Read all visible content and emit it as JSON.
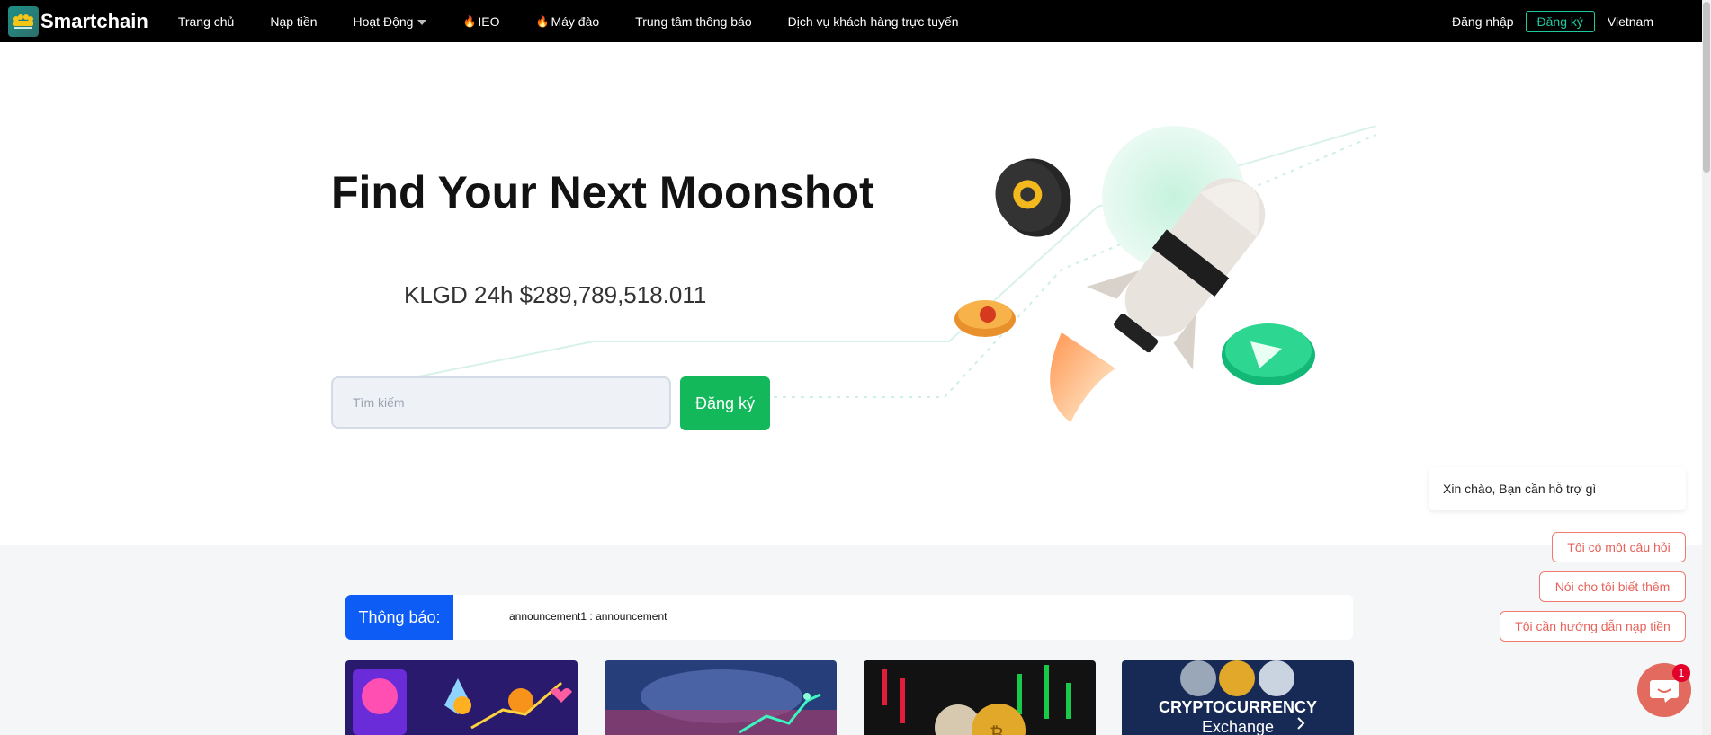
{
  "nav": {
    "brand": "Smartchain",
    "items": [
      {
        "label": "Trang chủ"
      },
      {
        "label": "Nạp tiền"
      },
      {
        "label": "Hoạt Động"
      },
      {
        "label": "IEO"
      },
      {
        "label": "Máy đào"
      },
      {
        "label": "Trung tâm thông báo"
      },
      {
        "label": "Dịch vụ khách hàng trực tuyến"
      }
    ],
    "login": "Đăng nhập",
    "register": "Đăng ký",
    "language": "Vietnam"
  },
  "hero": {
    "title": "Find Your Next Moonshot",
    "volume": "KLGD 24h $289,789,518.011",
    "search_placeholder": "Tìm kiếm",
    "button": "Đăng ký"
  },
  "notice": {
    "label": "Thông báo:",
    "text": "announcement1 : announcement"
  },
  "cards": [
    {
      "icon": "crypto-neon-image"
    },
    {
      "icon": "market-chart-image"
    },
    {
      "icon": "coins-chart-image"
    },
    {
      "icon": "cryptocurrency-exchange-image",
      "caption_1": "CRYPTOCURRENCY",
      "caption_2": "Exchange"
    }
  ],
  "chat": {
    "greeting": "Xin chào, Bạn cần hỗ trợ gì",
    "options": [
      {
        "label": "Tôi có một câu hỏi"
      },
      {
        "label": "Nói cho tôi biết thêm"
      },
      {
        "label": "Tôi cần hướng dẫn nạp tiền"
      }
    ],
    "badge": "1"
  },
  "colors": {
    "nav_bg": "#000000",
    "accent_green": "#12b85a",
    "notice_blue": "#0d5cf5",
    "chat_red": "#e26a5e"
  }
}
